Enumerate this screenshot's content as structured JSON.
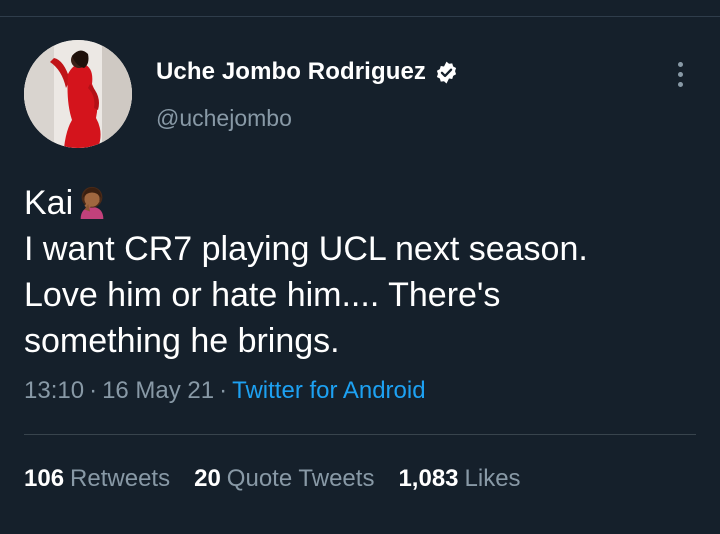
{
  "tweet": {
    "author": {
      "display_name": "Uche Jombo Rodriguez",
      "handle": "@uchejombo",
      "verified": true
    },
    "text_lines": [
      "Kai",
      " I want CR7 playing UCL next season.",
      "Love him or hate him.... There's",
      "something he brings."
    ],
    "emoji": "woman-facepalming-emoji",
    "time": "13:10",
    "date": "16 May 21",
    "source": "Twitter for Android",
    "separator": "·",
    "stats": {
      "retweets": {
        "count": "106",
        "label": "Retweets"
      },
      "quote_tweets": {
        "count": "20",
        "label": "Quote Tweets"
      },
      "likes": {
        "count": "1,083",
        "label": "Likes"
      }
    }
  },
  "colors": {
    "background": "#15202b",
    "text": "#ffffff",
    "secondary_text": "#8899a6",
    "accent": "#1da1f2",
    "divider": "#38444d"
  },
  "icons": {
    "verified": "verified-badge-icon",
    "more": "more-vertical-icon"
  }
}
